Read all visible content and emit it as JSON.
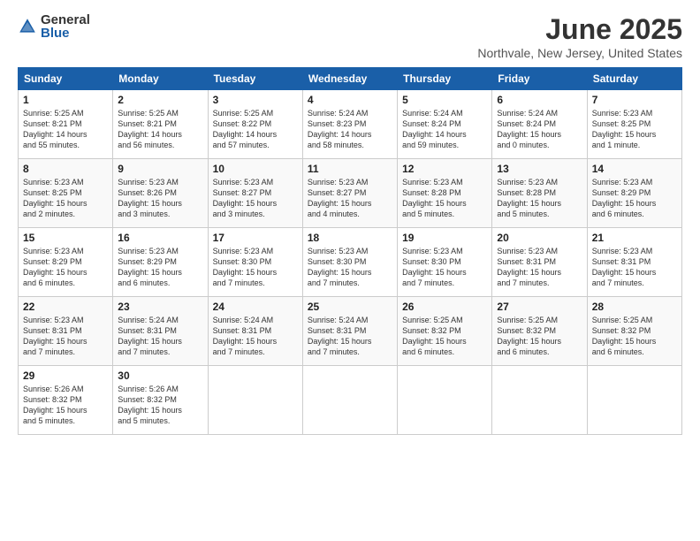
{
  "logo": {
    "general": "General",
    "blue": "Blue"
  },
  "header": {
    "month": "June 2025",
    "location": "Northvale, New Jersey, United States"
  },
  "days": [
    "Sunday",
    "Monday",
    "Tuesday",
    "Wednesday",
    "Thursday",
    "Friday",
    "Saturday"
  ],
  "weeks": [
    [
      {
        "day": "1",
        "info": "Sunrise: 5:25 AM\nSunset: 8:21 PM\nDaylight: 14 hours\nand 55 minutes."
      },
      {
        "day": "2",
        "info": "Sunrise: 5:25 AM\nSunset: 8:21 PM\nDaylight: 14 hours\nand 56 minutes."
      },
      {
        "day": "3",
        "info": "Sunrise: 5:25 AM\nSunset: 8:22 PM\nDaylight: 14 hours\nand 57 minutes."
      },
      {
        "day": "4",
        "info": "Sunrise: 5:24 AM\nSunset: 8:23 PM\nDaylight: 14 hours\nand 58 minutes."
      },
      {
        "day": "5",
        "info": "Sunrise: 5:24 AM\nSunset: 8:24 PM\nDaylight: 14 hours\nand 59 minutes."
      },
      {
        "day": "6",
        "info": "Sunrise: 5:24 AM\nSunset: 8:24 PM\nDaylight: 15 hours\nand 0 minutes."
      },
      {
        "day": "7",
        "info": "Sunrise: 5:23 AM\nSunset: 8:25 PM\nDaylight: 15 hours\nand 1 minute."
      }
    ],
    [
      {
        "day": "8",
        "info": "Sunrise: 5:23 AM\nSunset: 8:25 PM\nDaylight: 15 hours\nand 2 minutes."
      },
      {
        "day": "9",
        "info": "Sunrise: 5:23 AM\nSunset: 8:26 PM\nDaylight: 15 hours\nand 3 minutes."
      },
      {
        "day": "10",
        "info": "Sunrise: 5:23 AM\nSunset: 8:27 PM\nDaylight: 15 hours\nand 3 minutes."
      },
      {
        "day": "11",
        "info": "Sunrise: 5:23 AM\nSunset: 8:27 PM\nDaylight: 15 hours\nand 4 minutes."
      },
      {
        "day": "12",
        "info": "Sunrise: 5:23 AM\nSunset: 8:28 PM\nDaylight: 15 hours\nand 5 minutes."
      },
      {
        "day": "13",
        "info": "Sunrise: 5:23 AM\nSunset: 8:28 PM\nDaylight: 15 hours\nand 5 minutes."
      },
      {
        "day": "14",
        "info": "Sunrise: 5:23 AM\nSunset: 8:29 PM\nDaylight: 15 hours\nand 6 minutes."
      }
    ],
    [
      {
        "day": "15",
        "info": "Sunrise: 5:23 AM\nSunset: 8:29 PM\nDaylight: 15 hours\nand 6 minutes."
      },
      {
        "day": "16",
        "info": "Sunrise: 5:23 AM\nSunset: 8:29 PM\nDaylight: 15 hours\nand 6 minutes."
      },
      {
        "day": "17",
        "info": "Sunrise: 5:23 AM\nSunset: 8:30 PM\nDaylight: 15 hours\nand 7 minutes."
      },
      {
        "day": "18",
        "info": "Sunrise: 5:23 AM\nSunset: 8:30 PM\nDaylight: 15 hours\nand 7 minutes."
      },
      {
        "day": "19",
        "info": "Sunrise: 5:23 AM\nSunset: 8:30 PM\nDaylight: 15 hours\nand 7 minutes."
      },
      {
        "day": "20",
        "info": "Sunrise: 5:23 AM\nSunset: 8:31 PM\nDaylight: 15 hours\nand 7 minutes."
      },
      {
        "day": "21",
        "info": "Sunrise: 5:23 AM\nSunset: 8:31 PM\nDaylight: 15 hours\nand 7 minutes."
      }
    ],
    [
      {
        "day": "22",
        "info": "Sunrise: 5:23 AM\nSunset: 8:31 PM\nDaylight: 15 hours\nand 7 minutes."
      },
      {
        "day": "23",
        "info": "Sunrise: 5:24 AM\nSunset: 8:31 PM\nDaylight: 15 hours\nand 7 minutes."
      },
      {
        "day": "24",
        "info": "Sunrise: 5:24 AM\nSunset: 8:31 PM\nDaylight: 15 hours\nand 7 minutes."
      },
      {
        "day": "25",
        "info": "Sunrise: 5:24 AM\nSunset: 8:31 PM\nDaylight: 15 hours\nand 7 minutes."
      },
      {
        "day": "26",
        "info": "Sunrise: 5:25 AM\nSunset: 8:32 PM\nDaylight: 15 hours\nand 6 minutes."
      },
      {
        "day": "27",
        "info": "Sunrise: 5:25 AM\nSunset: 8:32 PM\nDaylight: 15 hours\nand 6 minutes."
      },
      {
        "day": "28",
        "info": "Sunrise: 5:25 AM\nSunset: 8:32 PM\nDaylight: 15 hours\nand 6 minutes."
      }
    ],
    [
      {
        "day": "29",
        "info": "Sunrise: 5:26 AM\nSunset: 8:32 PM\nDaylight: 15 hours\nand 5 minutes."
      },
      {
        "day": "30",
        "info": "Sunrise: 5:26 AM\nSunset: 8:32 PM\nDaylight: 15 hours\nand 5 minutes."
      },
      {
        "day": "",
        "info": ""
      },
      {
        "day": "",
        "info": ""
      },
      {
        "day": "",
        "info": ""
      },
      {
        "day": "",
        "info": ""
      },
      {
        "day": "",
        "info": ""
      }
    ]
  ]
}
